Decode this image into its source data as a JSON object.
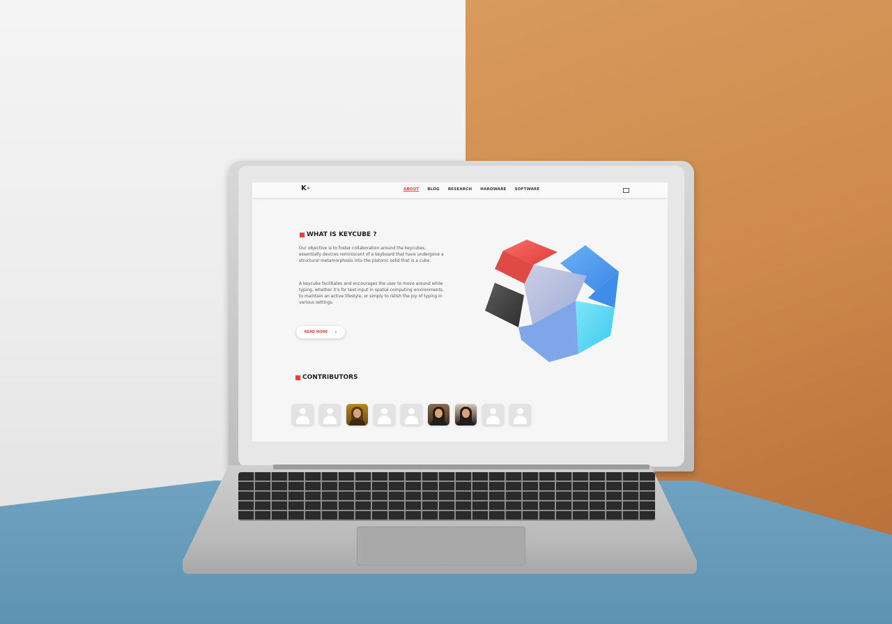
{
  "site": {
    "logo": "K",
    "nav": {
      "items": [
        {
          "label": "ABOUT",
          "active": true
        },
        {
          "label": "BLOG",
          "active": false
        },
        {
          "label": "RESEARCH",
          "active": false
        },
        {
          "label": "HARDWARE",
          "active": false
        },
        {
          "label": "SOFTWARE",
          "active": false
        }
      ]
    },
    "about": {
      "title": "WHAT IS KEYCUBE ?",
      "paragraph1": "Our objective is to foster collaboration around the keycubes, essentially devices reminiscent of a keyboard that have undergone a structural metamorphosis into the platonic solid that is a cube.",
      "paragraph2": "A keycube facilitates and encourages the user to move around while typing, whether it's for text input in spatial computing environments, to maintain an active lifestyle, or simply to relish the joy of typing in various settings.",
      "read_more_label": "READ MORE",
      "read_more_icon": "chevron-right-icon"
    },
    "contributors": {
      "title": "CONTRIBUTORS",
      "avatars": [
        {
          "type": "placeholder",
          "icon": "user-icon"
        },
        {
          "type": "placeholder",
          "icon": "user-icon"
        },
        {
          "type": "photo",
          "icon": "person-photo"
        },
        {
          "type": "placeholder",
          "icon": "user-icon"
        },
        {
          "type": "placeholder",
          "icon": "user-icon"
        },
        {
          "type": "photo",
          "icon": "person-photo"
        },
        {
          "type": "photo",
          "icon": "person-photo"
        },
        {
          "type": "placeholder",
          "icon": "user-icon"
        },
        {
          "type": "placeholder",
          "icon": "user-icon"
        }
      ]
    },
    "colors": {
      "accent": "#e0453c",
      "cube_red": "#ef5a55",
      "cube_blue": "#4f9ff2",
      "cube_cyan": "#49d8f3",
      "cube_dark": "#4a4a4a",
      "cube_white": "#f4f4f4"
    }
  }
}
